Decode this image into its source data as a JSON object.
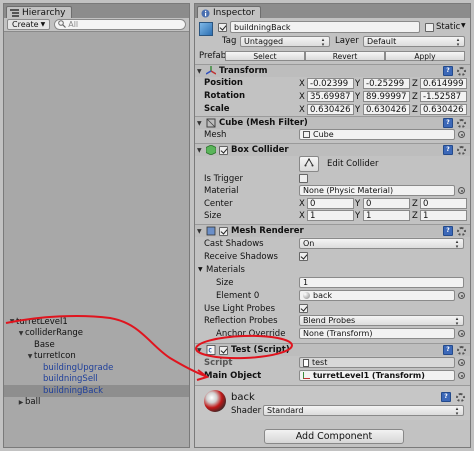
{
  "hierarchy": {
    "tab_label": "Hierarchy",
    "create_label": "Create",
    "search_placeholder": "All",
    "tree": [
      {
        "label": "turretLevel1",
        "depth": 0,
        "arrow": "down",
        "highlight": false,
        "blue": false
      },
      {
        "label": "colliderRange",
        "depth": 1,
        "arrow": "down",
        "highlight": false,
        "blue": false
      },
      {
        "label": "Base",
        "depth": 2,
        "arrow": "",
        "highlight": false,
        "blue": false
      },
      {
        "label": "turretIcon",
        "depth": 2,
        "arrow": "down",
        "highlight": false,
        "blue": false
      },
      {
        "label": "buildingUpgrade",
        "depth": 3,
        "arrow": "",
        "highlight": false,
        "blue": true
      },
      {
        "label": "buildningSell",
        "depth": 3,
        "arrow": "",
        "highlight": false,
        "blue": true
      },
      {
        "label": "buildningBack",
        "depth": 3,
        "arrow": "",
        "highlight": true,
        "blue": true
      },
      {
        "label": "ball",
        "depth": 1,
        "arrow": "right",
        "highlight": false,
        "blue": false
      }
    ]
  },
  "inspector": {
    "tab_label": "Inspector",
    "object_name": "buildningBack",
    "static_label": "Static",
    "tag_label": "Tag",
    "tag_value": "Untagged",
    "layer_label": "Layer",
    "layer_value": "Default",
    "prefab_label": "Prefab",
    "prefab_select": "Select",
    "prefab_revert": "Revert",
    "prefab_apply": "Apply",
    "transform": {
      "title": "Transform",
      "rows": [
        {
          "label": "Position",
          "x": "-0.02399",
          "y": "-0.25299",
          "z": "0.614999"
        },
        {
          "label": "Rotation",
          "x": "35.69987",
          "y": "89.99997",
          "z": "-1.52587"
        },
        {
          "label": "Scale",
          "x": "0.630426",
          "y": "0.630426",
          "z": "0.630426"
        }
      ]
    },
    "mesh_filter": {
      "title": "Cube (Mesh Filter)",
      "mesh_label": "Mesh",
      "mesh_value": "Cube"
    },
    "box_collider": {
      "title": "Box Collider",
      "edit_label": "Edit Collider",
      "is_trigger_label": "Is Trigger",
      "material_label": "Material",
      "material_value": "None (Physic Material)",
      "center_label": "Center",
      "center": {
        "x": "0",
        "y": "0",
        "z": "0"
      },
      "size_label": "Size",
      "size": {
        "x": "1",
        "y": "1",
        "z": "1"
      }
    },
    "mesh_renderer": {
      "title": "Mesh Renderer",
      "cast_shadows_label": "Cast Shadows",
      "cast_shadows_value": "On",
      "receive_shadows_label": "Receive Shadows",
      "materials_label": "Materials",
      "size_label": "Size",
      "size_value": "1",
      "element0_label": "Element 0",
      "element0_value": "back",
      "light_probes_label": "Use Light Probes",
      "reflection_label": "Reflection Probes",
      "reflection_value": "Blend Probes",
      "anchor_label": "Anchor Override",
      "anchor_value": "None (Transform)"
    },
    "test_script": {
      "title": "Test (Script)",
      "script_label": "Script",
      "script_value": "test",
      "main_object_label": "Main Object",
      "main_object_value": "turretLevel1 (Transform)"
    },
    "material": {
      "name": "back",
      "shader_label": "Shader",
      "shader_value": "Standard"
    },
    "add_component_label": "Add Component"
  },
  "colors": {
    "annotation": "#e0141e",
    "selection_text": "#1f3f9a"
  }
}
